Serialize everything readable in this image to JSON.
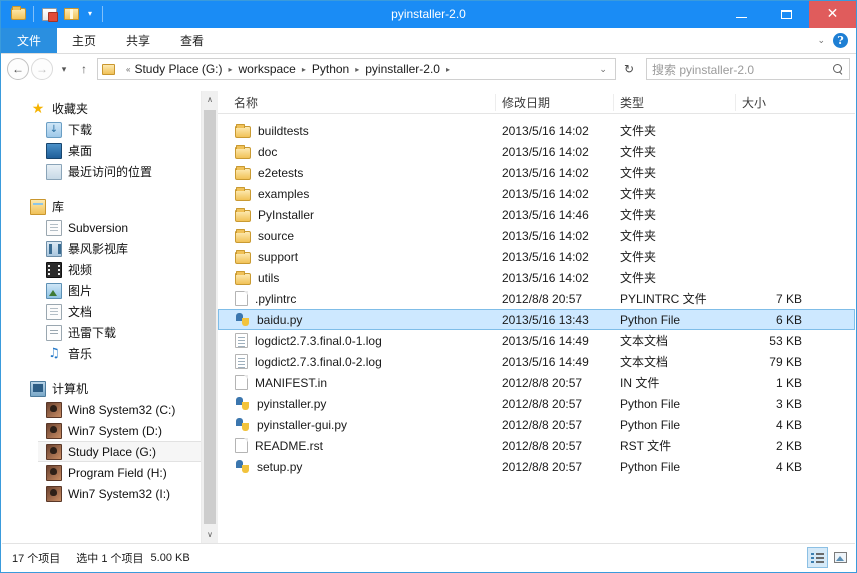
{
  "window": {
    "title": "pyinstaller-2.0",
    "accent_color": "#1a8cf5",
    "close_color": "#e05c5c",
    "selection_color": "#cde8ff"
  },
  "quick_access": [
    {
      "name": "folder-icon",
      "label": ""
    },
    {
      "name": "properties-icon",
      "label": ""
    },
    {
      "name": "new-folder-icon",
      "label": ""
    },
    {
      "name": "chevron-down-icon",
      "label": "▾"
    }
  ],
  "window_controls": {
    "minimize": "–",
    "maximize": "□",
    "close": "✕"
  },
  "ribbon": {
    "tabs": [
      {
        "label": "文件",
        "active": true
      },
      {
        "label": "主页",
        "active": false
      },
      {
        "label": "共享",
        "active": false
      },
      {
        "label": "查看",
        "active": false
      }
    ],
    "expand_chevron": "⌄",
    "help_label": "?"
  },
  "address_bar": {
    "back_label": "←",
    "forward_label": "→",
    "history_label": "▾",
    "up_label": "↑",
    "prefix": "«",
    "crumbs": [
      "Study Place (G:)",
      "workspace",
      "Python",
      "pyinstaller-2.0"
    ],
    "separator": "▸",
    "dropdown_chevron": "⌄",
    "refresh_label": "↻"
  },
  "search": {
    "placeholder": "搜索 pyinstaller-2.0",
    "icon": "search-icon"
  },
  "nav_pane": {
    "groups": [
      {
        "root": {
          "label": "收藏夹",
          "icon": "star-icon"
        },
        "items": [
          {
            "label": "下载",
            "icon": "downloads-icon"
          },
          {
            "label": "桌面",
            "icon": "desktop-icon"
          },
          {
            "label": "最近访问的位置",
            "icon": "recent-places-icon"
          }
        ]
      },
      {
        "root": {
          "label": "库",
          "icon": "libraries-icon"
        },
        "items": [
          {
            "label": "Subversion",
            "icon": "document-library-icon"
          },
          {
            "label": "暴风影视库",
            "icon": "video-library-icon"
          },
          {
            "label": "视频",
            "icon": "film-icon"
          },
          {
            "label": "图片",
            "icon": "pictures-icon"
          },
          {
            "label": "文档",
            "icon": "documents-icon"
          },
          {
            "label": "迅雷下载",
            "icon": "xunlei-icon"
          },
          {
            "label": "音乐",
            "icon": "music-icon"
          }
        ]
      },
      {
        "root": {
          "label": "计算机",
          "icon": "computer-icon"
        },
        "items": [
          {
            "label": "Win8 System32 (C:)",
            "icon": "drive-icon",
            "selected": false
          },
          {
            "label": "Win7 System (D:)",
            "icon": "drive-icon",
            "selected": false
          },
          {
            "label": "Study Place (G:)",
            "icon": "drive-icon",
            "selected": true
          },
          {
            "label": "Program Field (H:)",
            "icon": "drive-icon",
            "selected": false
          },
          {
            "label": "Win7 System32 (I:)",
            "icon": "drive-icon",
            "selected": false
          }
        ]
      }
    ],
    "scroll_up": "∧",
    "scroll_down": "∨"
  },
  "file_list": {
    "columns": [
      "名称",
      "修改日期",
      "类型",
      "大小"
    ],
    "rows": [
      {
        "name": "buildtests",
        "date": "2013/5/16 14:02",
        "type": "文件夹",
        "size": "",
        "icon": "folder-icon",
        "selected": false
      },
      {
        "name": "doc",
        "date": "2013/5/16 14:02",
        "type": "文件夹",
        "size": "",
        "icon": "folder-icon",
        "selected": false
      },
      {
        "name": "e2etests",
        "date": "2013/5/16 14:02",
        "type": "文件夹",
        "size": "",
        "icon": "folder-icon",
        "selected": false
      },
      {
        "name": "examples",
        "date": "2013/5/16 14:02",
        "type": "文件夹",
        "size": "",
        "icon": "folder-icon",
        "selected": false
      },
      {
        "name": "PyInstaller",
        "date": "2013/5/16 14:46",
        "type": "文件夹",
        "size": "",
        "icon": "folder-icon",
        "selected": false
      },
      {
        "name": "source",
        "date": "2013/5/16 14:02",
        "type": "文件夹",
        "size": "",
        "icon": "folder-icon",
        "selected": false
      },
      {
        "name": "support",
        "date": "2013/5/16 14:02",
        "type": "文件夹",
        "size": "",
        "icon": "folder-icon",
        "selected": false
      },
      {
        "name": "utils",
        "date": "2013/5/16 14:02",
        "type": "文件夹",
        "size": "",
        "icon": "folder-icon",
        "selected": false
      },
      {
        "name": ".pylintrc",
        "date": "2012/8/8 20:57",
        "type": "PYLINTRC 文件",
        "size": "7 KB",
        "icon": "file-icon",
        "selected": false
      },
      {
        "name": "baidu.py",
        "date": "2013/5/16 13:43",
        "type": "Python File",
        "size": "6 KB",
        "icon": "python-file-icon",
        "selected": true
      },
      {
        "name": "logdict2.7.3.final.0-1.log",
        "date": "2013/5/16 14:49",
        "type": "文本文档",
        "size": "53 KB",
        "icon": "text-file-icon",
        "selected": false
      },
      {
        "name": "logdict2.7.3.final.0-2.log",
        "date": "2013/5/16 14:49",
        "type": "文本文档",
        "size": "79 KB",
        "icon": "text-file-icon",
        "selected": false
      },
      {
        "name": "MANIFEST.in",
        "date": "2012/8/8 20:57",
        "type": "IN 文件",
        "size": "1 KB",
        "icon": "file-icon",
        "selected": false
      },
      {
        "name": "pyinstaller.py",
        "date": "2012/8/8 20:57",
        "type": "Python File",
        "size": "3 KB",
        "icon": "python-file-icon",
        "selected": false
      },
      {
        "name": "pyinstaller-gui.py",
        "date": "2012/8/8 20:57",
        "type": "Python File",
        "size": "4 KB",
        "icon": "python-file-icon",
        "selected": false
      },
      {
        "name": "README.rst",
        "date": "2012/8/8 20:57",
        "type": "RST 文件",
        "size": "2 KB",
        "icon": "file-icon",
        "selected": false
      },
      {
        "name": "setup.py",
        "date": "2012/8/8 20:57",
        "type": "Python File",
        "size": "4 KB",
        "icon": "python-file-icon",
        "selected": false
      }
    ]
  },
  "status_bar": {
    "item_count": "17 个项目",
    "selected_text": "选中 1 个项目",
    "selected_size": "5.00 KB",
    "views": [
      {
        "name": "details-view-button",
        "active": true
      },
      {
        "name": "large-icons-view-button",
        "active": false
      }
    ]
  }
}
